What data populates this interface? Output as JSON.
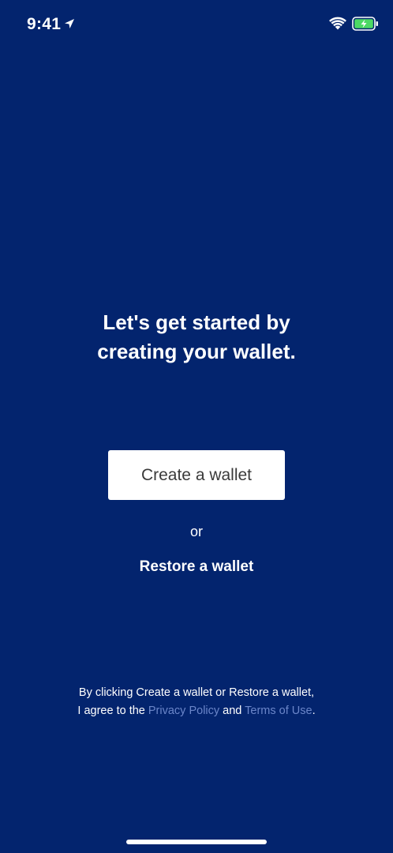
{
  "status_bar": {
    "time": "9:41",
    "icons": [
      "location-arrow-icon",
      "wifi-icon",
      "battery-charging-icon"
    ]
  },
  "colors": {
    "background": "#03246e",
    "text": "#ffffff",
    "button_background": "#ffffff",
    "button_text": "#3a3a3a",
    "link": "#6b86c9",
    "battery_fill": "#4cd964"
  },
  "onboarding": {
    "headline_line1": "Let's get started by",
    "headline_line2": "creating your wallet.",
    "create_label": "Create a wallet",
    "or_label": "or",
    "restore_label": "Restore a wallet"
  },
  "legal": {
    "line1": "By clicking Create a wallet or Restore a wallet,",
    "prefix": "I agree to the ",
    "privacy_link": "Privacy Policy",
    "conjunction": " and ",
    "terms_link": "Terms of Use",
    "suffix": "."
  }
}
